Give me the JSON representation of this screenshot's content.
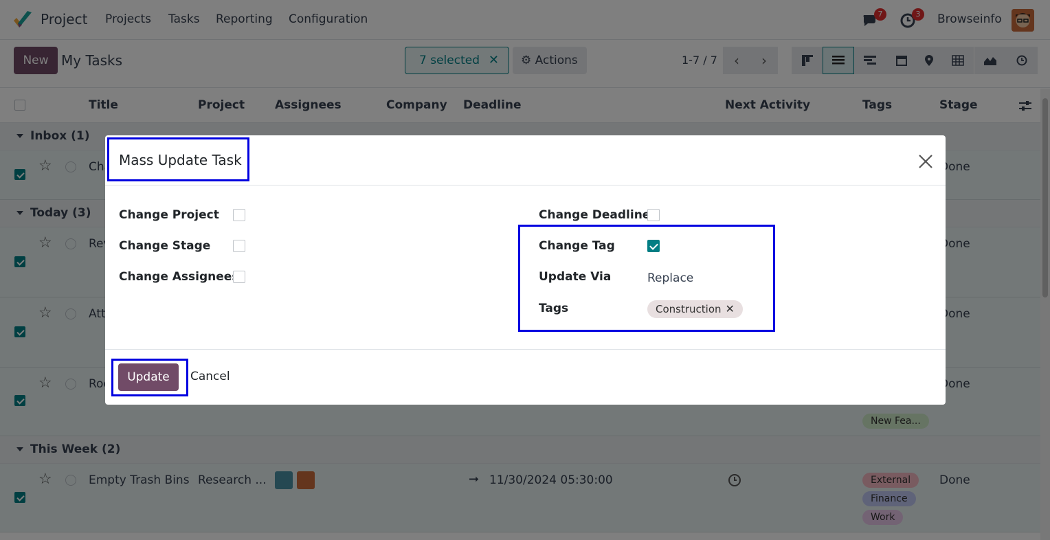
{
  "nav": {
    "app_name": "Project",
    "menu": [
      "Projects",
      "Tasks",
      "Reporting",
      "Configuration"
    ],
    "messages_badge": "7",
    "activities_badge": "3",
    "username": "Browseinfo"
  },
  "control_panel": {
    "new_label": "New",
    "title": "My Tasks",
    "selected_label": "7 selected",
    "actions_label": "Actions",
    "pager": "1-7 / 7"
  },
  "list": {
    "columns": [
      "Title",
      "Project",
      "Assignees",
      "Company",
      "Deadline",
      "Next Activity",
      "Tags",
      "Stage"
    ],
    "groups": [
      {
        "label": "Inbox (1)"
      },
      {
        "label": "Today (3)"
      },
      {
        "label": "This Week (2)"
      }
    ],
    "rows": [
      {
        "title": "Cha",
        "stage": "Done"
      },
      {
        "title": "Rev",
        "stage": "Done"
      },
      {
        "title": "Att",
        "stage": "Done"
      },
      {
        "title": "Roo",
        "stage": "Done",
        "tags": [
          "New Fea..."
        ]
      },
      {
        "title": "Empty Trash Bins",
        "project": "Research ...",
        "deadline": "11/30/2024 05:30:00",
        "stage": "Done",
        "tags": [
          "External",
          "Finance",
          "Work"
        ]
      }
    ]
  },
  "modal": {
    "title": "Mass Update Task",
    "fields": {
      "change_project": "Change Project",
      "change_stage": "Change Stage",
      "change_assignees": "Change Assignees",
      "change_deadline": "Change Deadline",
      "change_tag": "Change Tag",
      "update_via": "Update Via",
      "update_via_value": "Replace",
      "tags": "Tags",
      "tag_value": "Construction"
    },
    "update_label": "Update",
    "cancel_label": "Cancel"
  },
  "colors": {
    "brand": "#714b67",
    "accent": "#017e84",
    "highlight_box": "#0000e0"
  }
}
